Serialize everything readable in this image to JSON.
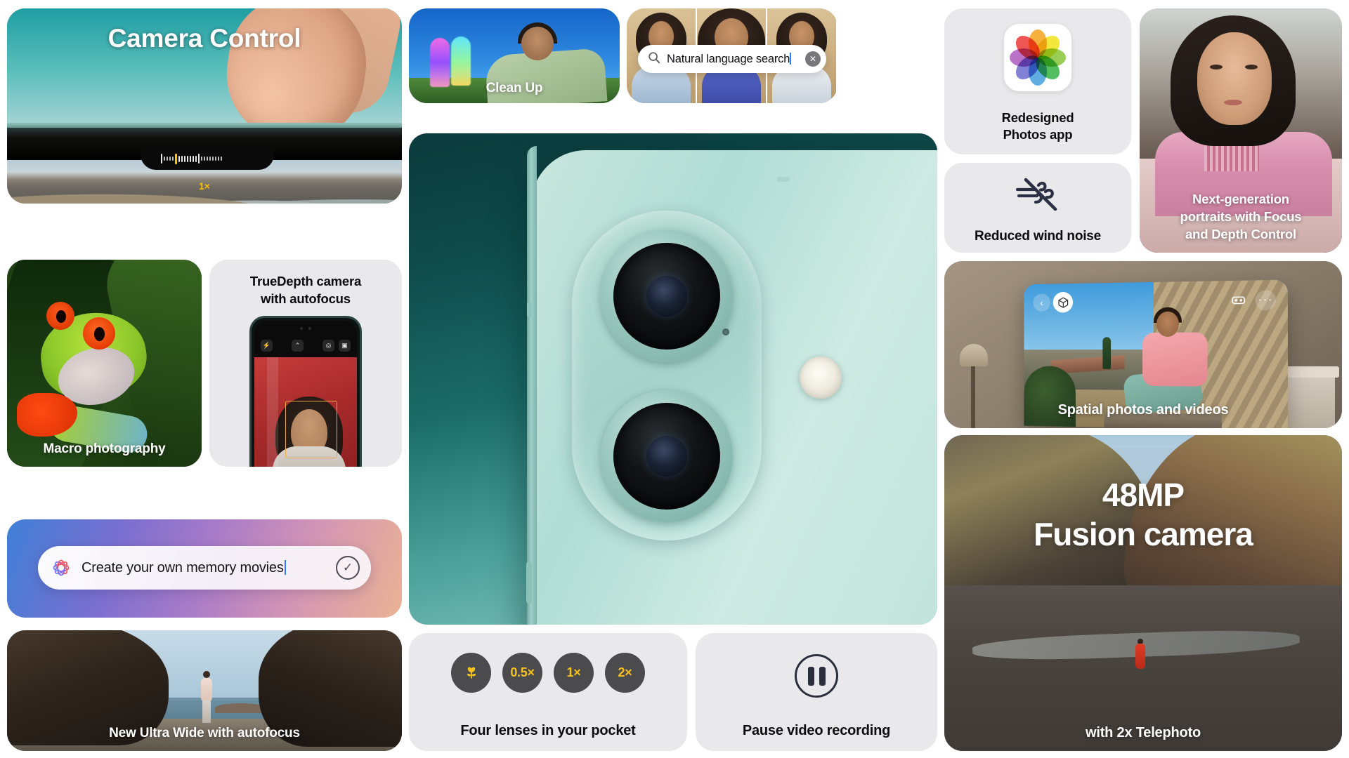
{
  "page": {
    "title": "iPhone 16 camera features grid",
    "background_color": "#ffffff",
    "card_gray": "#e9e9eb"
  },
  "cards": {
    "camera_control": {
      "title": "Camera Control",
      "zoom_label": "1×",
      "zoom_accent_color": "#ffc400",
      "slider_name": "zoom-slider"
    },
    "clean_up": {
      "caption": "Clean Up"
    },
    "natural_language_search": {
      "query": "Natural language search",
      "search_icon": "search-icon",
      "clear_icon": "clear-icon"
    },
    "photos_app": {
      "caption_line1": "Redesigned",
      "caption_line2": "Photos app",
      "icon_name": "photos-app-icon"
    },
    "portraits": {
      "caption_line1": "Next-generation",
      "caption_line2": "portraits with Focus",
      "caption_line3": "and Depth Control"
    },
    "wind_noise": {
      "caption": "Reduced wind noise",
      "icon_name": "wind-noise-off-icon"
    },
    "macro": {
      "caption": "Macro photography"
    },
    "truedepth": {
      "title_line1": "TrueDepth camera",
      "title_line2": "with autofocus",
      "phone_ui": {
        "flash_icon": "⚡",
        "chevron_icon": "⌃",
        "settings_icon": "◎",
        "aspect_icon": "▣"
      }
    },
    "memory_movies": {
      "text": "Create your own memory movies",
      "ai_icon": "apple-intelligence-icon",
      "submit_icon": "checkmark-circle-icon"
    },
    "ultra_wide": {
      "caption": "New Ultra Wide with autofocus"
    },
    "hero_iphone": {
      "description": "iPhone rear camera module"
    },
    "four_lenses": {
      "caption": "Four lenses in your pocket",
      "chips": [
        {
          "label": "🌷",
          "name": "macro-lens-chip",
          "is_icon": true
        },
        {
          "label": "0.5×",
          "name": "ultrawide-lens-chip",
          "is_icon": false
        },
        {
          "label": "1×",
          "name": "wide-lens-chip",
          "is_icon": false
        },
        {
          "label": "2×",
          "name": "telephoto-lens-chip",
          "is_icon": false
        }
      ],
      "chip_bg_color": "#4b4b4d",
      "chip_text_color": "#f4c11f"
    },
    "pause_video": {
      "caption": "Pause video recording",
      "icon_name": "pause-circle-icon"
    },
    "spatial": {
      "caption": "Spatial photos and videos",
      "back_icon": "‹",
      "cube_icon": "⬡",
      "immersive_icon": "⬛",
      "more_icon": "···"
    },
    "fusion": {
      "line1": "48MP",
      "line2": "Fusion camera",
      "subtitle": "with 2x Telephoto"
    }
  }
}
